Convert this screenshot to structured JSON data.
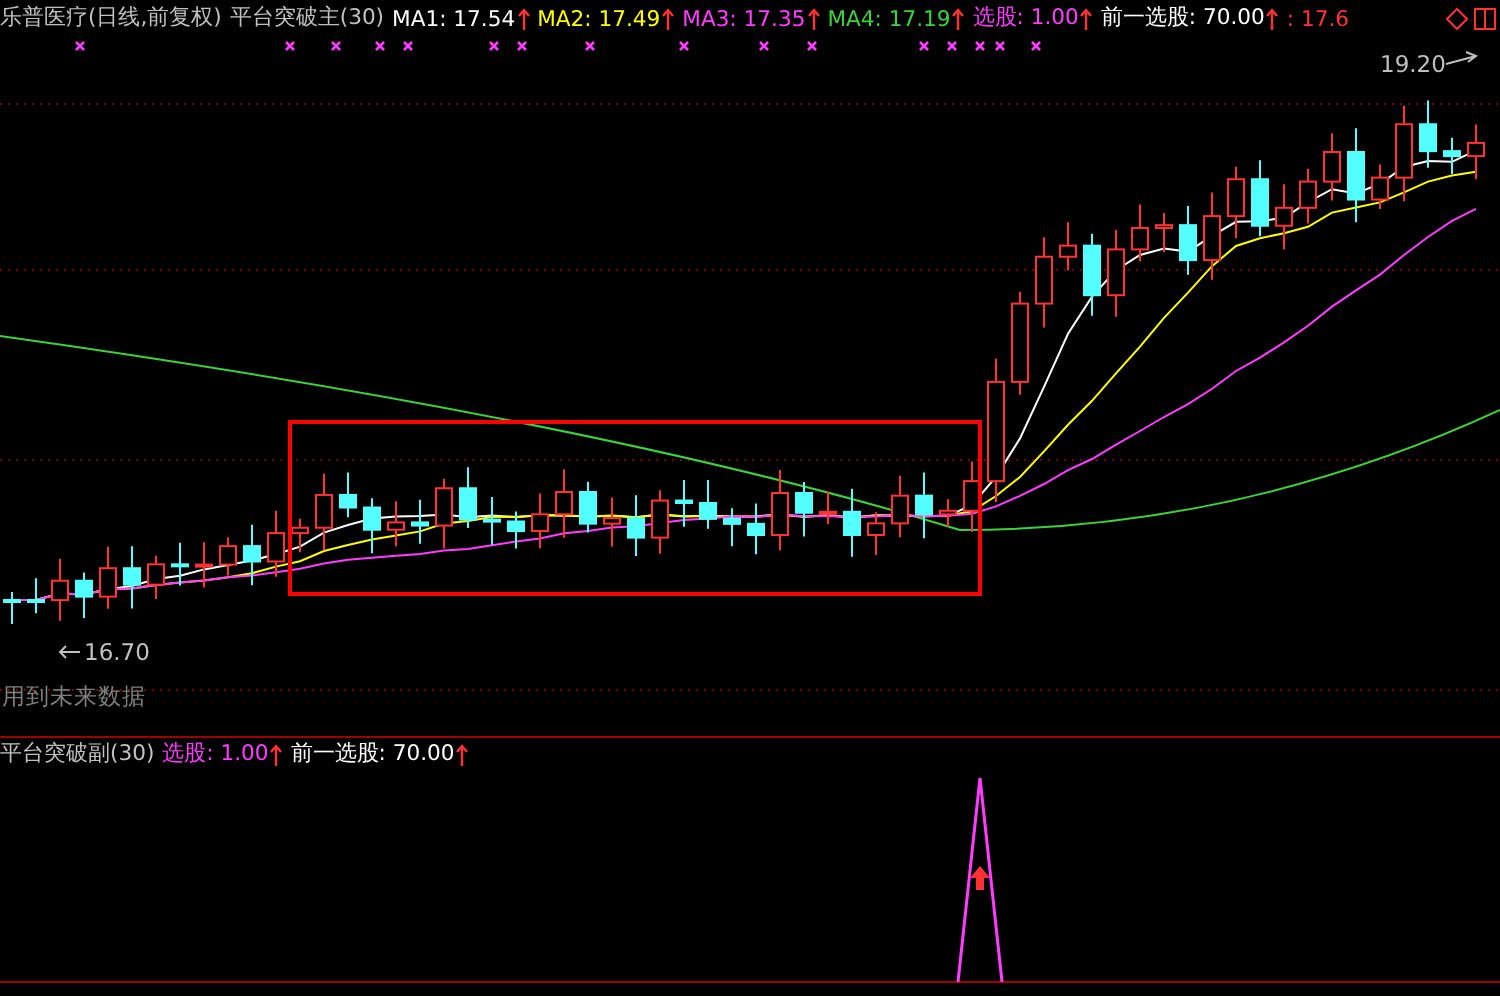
{
  "main_panel": {
    "legend": [
      {
        "kind": "title",
        "text": "乐普医疗(日线,前复权)",
        "color": "#c0c0c0"
      },
      {
        "kind": "title",
        "text": "平台突破主(30)",
        "color": "#c0c0c0"
      },
      {
        "kind": "indicator",
        "text": "MA1: 17.54",
        "color": "#ffffff"
      },
      {
        "kind": "indicator",
        "text": "MA2: 17.49",
        "color": "#ffff00"
      },
      {
        "kind": "indicator",
        "text": "MA3: 17.35",
        "color": "#ff3cff"
      },
      {
        "kind": "indicator",
        "text": "MA4: 17.19",
        "color": "#3cd23c"
      },
      {
        "kind": "indicator",
        "text": "选股: 1.00",
        "color": "#ff3cff"
      },
      {
        "kind": "indicator",
        "text": "前一选股: 70.00",
        "color": "#ffffff"
      },
      {
        "kind": "title",
        "text": ": 17.6",
        "color": "#ff3232"
      }
    ],
    "high_label": "19.20",
    "low_label": "16.70",
    "warning": "用到未来数据"
  },
  "sub_panel": {
    "legend": [
      {
        "kind": "title",
        "text": "平台突破副(30)",
        "color": "#c0c0c0"
      },
      {
        "kind": "indicator",
        "text": "选股: 1.00",
        "color": "#ff3cff"
      },
      {
        "kind": "indicator",
        "text": "前一选股: 70.00",
        "color": "#ffffff"
      }
    ]
  }
}
